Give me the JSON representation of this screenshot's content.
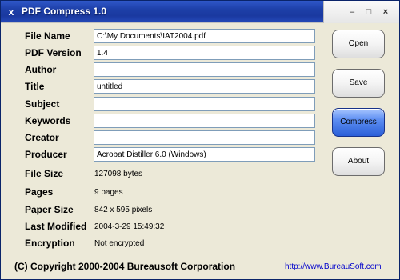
{
  "window": {
    "title": "PDF Compress 1.0"
  },
  "titlebar": {
    "minimize": "–",
    "maximize": "□",
    "close": "×",
    "app_icon": "x"
  },
  "fields": [
    {
      "label": "File Name",
      "value": "C:\\My Documents\\IAT2004.pdf"
    },
    {
      "label": "PDF Version",
      "value": "1.4"
    },
    {
      "label": "Author",
      "value": ""
    },
    {
      "label": "Title",
      "value": "untitled"
    },
    {
      "label": "Subject",
      "value": ""
    },
    {
      "label": "Keywords",
      "value": ""
    },
    {
      "label": "Creator",
      "value": ""
    },
    {
      "label": "Producer",
      "value": "Acrobat Distiller 6.0 (Windows)"
    }
  ],
  "info": [
    {
      "label": "File Size",
      "value": "127098 bytes"
    },
    {
      "label": "Pages",
      "value": "9 pages"
    },
    {
      "label": "Paper Size",
      "value": "842 x 595 pixels"
    },
    {
      "label": "Last Modified",
      "value": "2004-3-29 15:49:32"
    },
    {
      "label": "Encryption",
      "value": "Not encrypted"
    }
  ],
  "buttons": {
    "open": "Open",
    "save": "Save",
    "compress": "Compress",
    "about": "About"
  },
  "footer": {
    "copyright": "(C) Copyright 2000-2004 Bureausoft Corporation",
    "link": "http://www.BureauSoft.com"
  },
  "colors": {
    "titlebar": "#1d3fa8",
    "window_bg": "#ece9d8",
    "active_button": "#2a5fd8",
    "link": "#0000cc"
  }
}
